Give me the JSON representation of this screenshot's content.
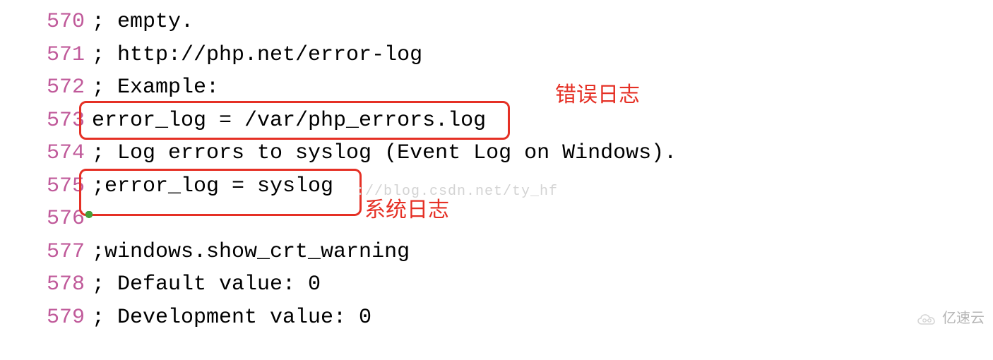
{
  "lines": [
    {
      "num": "570",
      "text": "; empty."
    },
    {
      "num": "571",
      "text": "; http://php.net/error-log"
    },
    {
      "num": "572",
      "text": "; Example:"
    },
    {
      "num": "573",
      "text": "error_log = /var/php_errors.log"
    },
    {
      "num": "574",
      "text": "; Log errors to syslog (Event Log on Windows)."
    },
    {
      "num": "575",
      "text": ";error_log = syslog"
    },
    {
      "num": "576",
      "text": ""
    },
    {
      "num": "577",
      "text": ";windows.show_crt_warning"
    },
    {
      "num": "578",
      "text": "; Default value: 0"
    },
    {
      "num": "579",
      "text": "; Development value: 0"
    }
  ],
  "annotations": {
    "err_log_label": "错误日志",
    "sys_log_label": "系统日志"
  },
  "watermarks": {
    "csdn": "://blog.csdn.net/ty_hf",
    "yisu": "亿速云"
  },
  "cursor_line": "573",
  "cursor_col": 0
}
